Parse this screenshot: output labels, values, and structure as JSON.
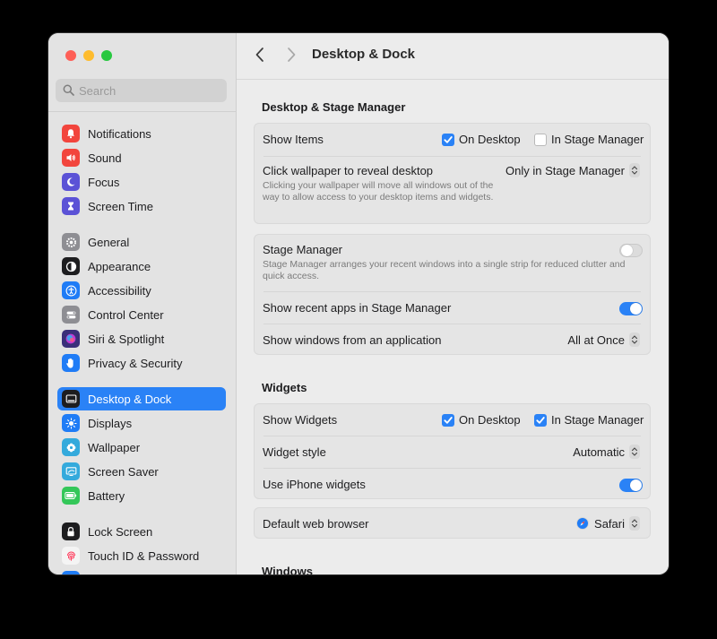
{
  "colors": {
    "accent": "#2a82f6",
    "close": "#fe5f57",
    "minimize": "#febc2e",
    "zoom": "#28c840"
  },
  "search": {
    "placeholder": "Search"
  },
  "sidebar": {
    "items": [
      {
        "label": "Notifications",
        "icon": "bell-icon",
        "color": "#f2453d"
      },
      {
        "label": "Sound",
        "icon": "speaker-icon",
        "color": "#f2453d"
      },
      {
        "label": "Focus",
        "icon": "moon-icon",
        "color": "#5b52d6"
      },
      {
        "label": "Screen Time",
        "icon": "hourglass-icon",
        "color": "#5b52d6"
      },
      {
        "label": "General",
        "icon": "gear-icon",
        "color": "#8e8e93"
      },
      {
        "label": "Appearance",
        "icon": "appearance-icon",
        "color": "#1d1d1f"
      },
      {
        "label": "Accessibility",
        "icon": "accessibility-icon",
        "color": "#1f7cf6"
      },
      {
        "label": "Control Center",
        "icon": "control-center-icon",
        "color": "#8e8e93"
      },
      {
        "label": "Siri & Spotlight",
        "icon": "siri-icon",
        "color": "#3a2f7a"
      },
      {
        "label": "Privacy & Security",
        "icon": "hand-icon",
        "color": "#1f7cf6"
      },
      {
        "label": "Desktop & Dock",
        "icon": "dock-icon",
        "color": "#1d1d1f",
        "selected": true
      },
      {
        "label": "Displays",
        "icon": "sun-icon",
        "color": "#1f7cf6"
      },
      {
        "label": "Wallpaper",
        "icon": "flower-icon",
        "color": "#34aadc"
      },
      {
        "label": "Screen Saver",
        "icon": "screensaver-icon",
        "color": "#34aadc"
      },
      {
        "label": "Battery",
        "icon": "battery-icon",
        "color": "#34c759"
      },
      {
        "label": "Lock Screen",
        "icon": "lock-icon",
        "color": "#1d1d1f"
      },
      {
        "label": "Touch ID & Password",
        "icon": "fingerprint-icon",
        "color": "#f2f2f2"
      }
    ]
  },
  "toolbar": {
    "title": "Desktop & Dock"
  },
  "desktop_section": {
    "title": "Desktop & Stage Manager",
    "show_items": {
      "label": "Show Items",
      "on_desktop": "On Desktop",
      "on_desktop_checked": true,
      "in_stage_manager": "In Stage Manager",
      "in_stage_manager_checked": false
    },
    "click_wallpaper": {
      "label": "Click wallpaper to reveal desktop",
      "description": "Clicking your wallpaper will move all windows out of the way to allow access to your desktop items and widgets.",
      "value": "Only in Stage Manager"
    }
  },
  "stage_manager": {
    "label": "Stage Manager",
    "description": "Stage Manager arranges your recent windows into a single strip for reduced clutter and quick access.",
    "enabled": false,
    "recent_apps": {
      "label": "Show recent apps in Stage Manager",
      "enabled": true
    },
    "windows_from_app": {
      "label": "Show windows from an application",
      "value": "All at Once"
    }
  },
  "widgets_section": {
    "title": "Widgets",
    "show_widgets": {
      "label": "Show Widgets",
      "on_desktop": "On Desktop",
      "on_desktop_checked": true,
      "in_stage_manager": "In Stage Manager",
      "in_stage_manager_checked": true
    },
    "widget_style": {
      "label": "Widget style",
      "value": "Automatic"
    },
    "iphone_widgets": {
      "label": "Use iPhone widgets",
      "enabled": true
    }
  },
  "browser": {
    "label": "Default web browser",
    "value": "Safari",
    "icon": "safari-icon"
  },
  "windows_section": {
    "title": "Windows"
  }
}
